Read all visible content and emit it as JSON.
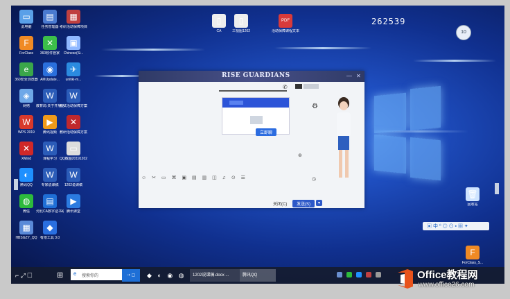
{
  "desktop": {
    "counter": "262539",
    "left_icons": [
      {
        "label": "此电脑",
        "glyph": "▭",
        "color": "#5aa0e8"
      },
      {
        "label": "任务管理器",
        "glyph": "▤",
        "color": "#4a7ad0"
      },
      {
        "label": "考研活动保障项目",
        "glyph": "▦",
        "color": "#c04040"
      },
      {
        "label": "ForClass",
        "glyph": "F",
        "color": "#f08a24"
      },
      {
        "label": "360软件管家",
        "glyph": "✕",
        "color": "#3cbf4a"
      },
      {
        "label": "Chinese(Si...",
        "glyph": "▣",
        "color": "#8fb8ff"
      },
      {
        "label": "360安全浏览器",
        "glyph": "e",
        "color": "#3aa64a"
      },
      {
        "label": "AMUpdate...",
        "glyph": "◉",
        "color": "#2a6fdc"
      },
      {
        "label": "unitiki-m...",
        "glyph": "✈",
        "color": "#2b8be0"
      },
      {
        "label": "网络",
        "glyph": "◈",
        "color": "#6ea8e8"
      },
      {
        "label": "教育局:关于开展活动",
        "glyph": "W",
        "color": "#2b5cb8"
      },
      {
        "label": "考试活动保障方案",
        "glyph": "W",
        "color": "#2b5cb8"
      },
      {
        "label": "WPS 2019",
        "glyph": "W",
        "color": "#d8392b"
      },
      {
        "label": "腾讯视频",
        "glyph": "▶",
        "color": "#f09a1a"
      },
      {
        "label": "教研活动保障方案",
        "glyph": "✕",
        "color": "#c0282d"
      },
      {
        "label": "XMind",
        "glyph": "✕",
        "color": "#d02828"
      },
      {
        "label": "课程学习",
        "glyph": "W",
        "color": "#2b5cb8"
      },
      {
        "label": "QQ截图20191202...",
        "glyph": "▭",
        "color": "#dddddd"
      },
      {
        "label": "腾讯QQ",
        "glyph": "◐",
        "color": "#1e90ff"
      },
      {
        "label": "专家说课稿",
        "glyph": "W",
        "color": "#2b5cb8"
      },
      {
        "label": "1202说课稿",
        "glyph": "W",
        "color": "#2b5cb8"
      },
      {
        "label": "微信",
        "glyph": "◍",
        "color": "#2dbb3c"
      },
      {
        "label": "河北CA数字证书助手V6",
        "glyph": "▤",
        "color": "#1f6fd6"
      },
      {
        "label": "腾讯课堂",
        "glyph": "▶",
        "color": "#2b7be0"
      },
      {
        "label": "HBSGZY_QQ",
        "glyph": "▦",
        "color": "#5a8ad8"
      },
      {
        "label": "有限工具 3.0",
        "glyph": "◆",
        "color": "#2a6fe0"
      }
    ],
    "top_icons": [
      {
        "label": "CA",
        "glyph": "▯",
        "color": "#eeeeee"
      },
      {
        "label": "三视图1202",
        "glyph": "▯",
        "color": "#eeeeee"
      },
      {
        "label": "活动保障课程文本",
        "glyph": "PDF",
        "color": "#d83a3a"
      }
    ],
    "right_icons": [
      {
        "label": "回收站",
        "glyph": "🗑",
        "color": "#cfe4ff"
      },
      {
        "label": "ForClass_S...",
        "glyph": "F",
        "color": "#f08a24"
      }
    ],
    "right_badge": "10"
  },
  "dialog": {
    "title": "RISE GUARDIANS",
    "chat_button": "立即聊",
    "cancel_label": "关闭(C)",
    "send_label": "发送(S)"
  },
  "taskbar": {
    "search_placeholder": "搜索你的",
    "tasks": [
      "1202说课稿.docx ...",
      "腾讯QQ"
    ]
  },
  "watermark": {
    "brand": "Office教程网",
    "url": "www.office26.com"
  }
}
